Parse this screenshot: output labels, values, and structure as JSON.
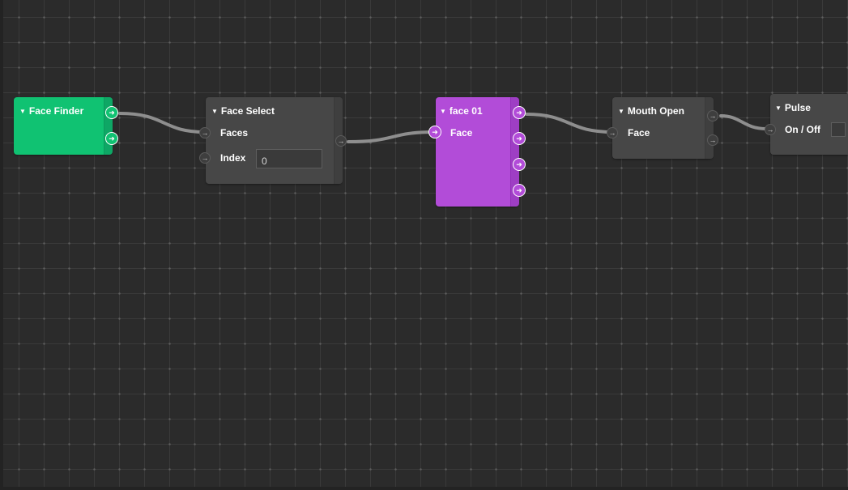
{
  "nodes": {
    "face_finder": {
      "title": "Face Finder",
      "color": "#10c272"
    },
    "face_select": {
      "title": "Face Select",
      "inputs": [
        "Faces",
        "Index"
      ],
      "index_value": "0"
    },
    "face_01": {
      "title": "face 01",
      "color": "#b24cd8",
      "inputs": [
        "Face"
      ]
    },
    "mouth_open": {
      "title": "Mouth Open",
      "inputs": [
        "Face"
      ]
    },
    "pulse": {
      "title": "Pulse",
      "inputs": [
        "On / Off"
      ]
    }
  },
  "icons": {
    "port": "arrow-right-icon",
    "collapse": "caret-down-icon"
  },
  "colors": {
    "canvas": "#2b2b2b",
    "node": "#474747",
    "wire": "#8e8e8e"
  }
}
